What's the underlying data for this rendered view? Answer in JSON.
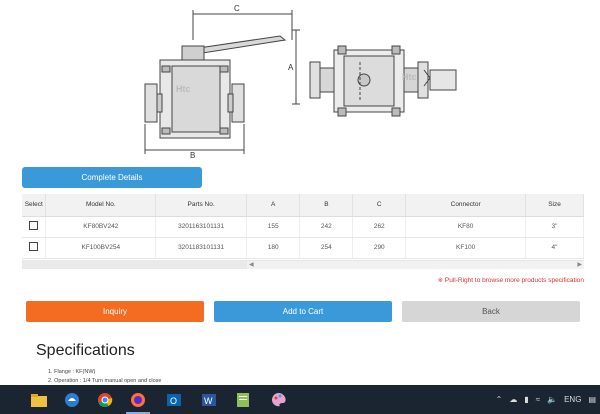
{
  "drawing": {
    "dim_c": "C",
    "dim_a": "A",
    "dim_b": "B",
    "watermark": "Htc"
  },
  "details_button": "Complete Details",
  "table": {
    "fixed_headers": [
      "Select",
      "Model No.",
      "Parts No."
    ],
    "scroll_headers": [
      "A",
      "B",
      "C",
      "Connector",
      "Size"
    ],
    "rows": [
      {
        "model": "KF80BV242",
        "parts": "3201163101131",
        "a": "155",
        "b": "242",
        "c": "262",
        "connector": "KF80",
        "size": "3\""
      },
      {
        "model": "KF100BV254",
        "parts": "3201183101131",
        "a": "180",
        "b": "254",
        "c": "290",
        "connector": "KF100",
        "size": "4\""
      }
    ]
  },
  "hint": "※ Pull-Right to browse more products specification",
  "buttons": {
    "inquiry": "Inquiry",
    "cart": "Add to Cart",
    "back": "Back"
  },
  "specifications": {
    "title": "Specifications",
    "items": [
      "1. Flange : KF(NW)",
      "2. Operation : 1/4 Turn manual open and close"
    ]
  },
  "taskbar": {
    "apps": [
      "file-explorer",
      "edge",
      "chrome",
      "firefox",
      "outlook",
      "word",
      "notepad",
      "paint"
    ],
    "language": "ENG",
    "colors": {
      "taskbar_bg": "#1b2431"
    }
  },
  "colors": {
    "primary": "#3a9ad9",
    "accent": "#f36c21",
    "back": "#d6d6d6",
    "hint": "#e03030"
  }
}
